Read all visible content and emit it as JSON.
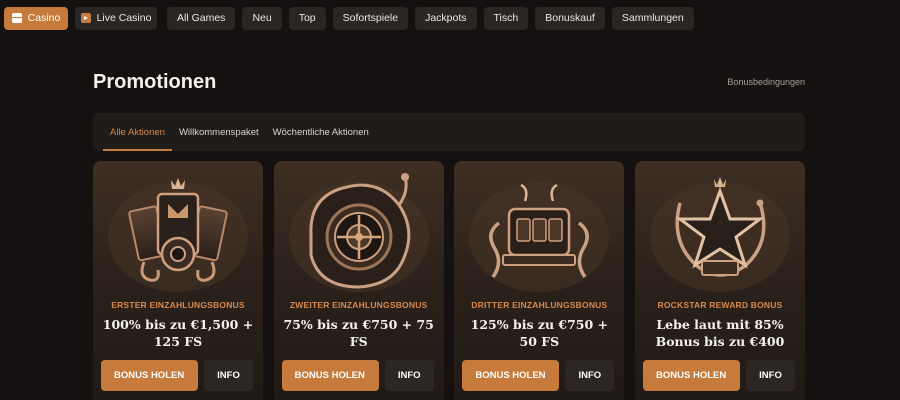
{
  "nav": {
    "items": [
      {
        "label": "Casino",
        "icon": "chest-icon",
        "style": "primary"
      },
      {
        "label": "Live Casino",
        "icon": "play-icon",
        "style": "live"
      },
      {
        "label": "All Games"
      },
      {
        "label": "Neu"
      },
      {
        "label": "Top"
      },
      {
        "label": "Sofortspiele"
      },
      {
        "label": "Jackpots"
      },
      {
        "label": "Tisch"
      },
      {
        "label": "Bonuskauf"
      },
      {
        "label": "Sammlungen"
      }
    ]
  },
  "header": {
    "title": "Promotionen",
    "terms_link": "Bonusbedingungen"
  },
  "tabs": [
    {
      "label": "Alle Aktionen",
      "active": true
    },
    {
      "label": "Willkommenspaket",
      "active": false
    },
    {
      "label": "Wöchentliche Aktionen",
      "active": false
    }
  ],
  "cards": [
    {
      "title": "ERSTER EINZAHLUNGSBONUS",
      "offer": "100% bis zu €1,500 + 125 FS",
      "bonus_btn": "BONUS HOLEN",
      "info_btn": "INFO",
      "art": "cards-crown-icon"
    },
    {
      "title": "ZWEITER EINZAHLUNGSBONUS",
      "offer": "75% bis zu €750 + 75 FS",
      "bonus_btn": "BONUS HOLEN",
      "info_btn": "INFO",
      "art": "roulette-snake-icon"
    },
    {
      "title": "DRITTER EINZAHLUNGSBONUS",
      "offer": "125% bis zu €750 + 50 FS",
      "bonus_btn": "BONUS HOLEN",
      "info_btn": "INFO",
      "art": "slot-machine-icon"
    },
    {
      "title": "ROCKSTAR REWARD BONUS",
      "offer": "Lebe laut mit 85% Bonus bis zu €400",
      "bonus_btn": "BONUS HOLEN",
      "info_btn": "INFO",
      "art": "star-snake-icon"
    }
  ],
  "colors": {
    "accent": "#c67a3c",
    "background": "#141110",
    "card_title": "#d8884c"
  }
}
